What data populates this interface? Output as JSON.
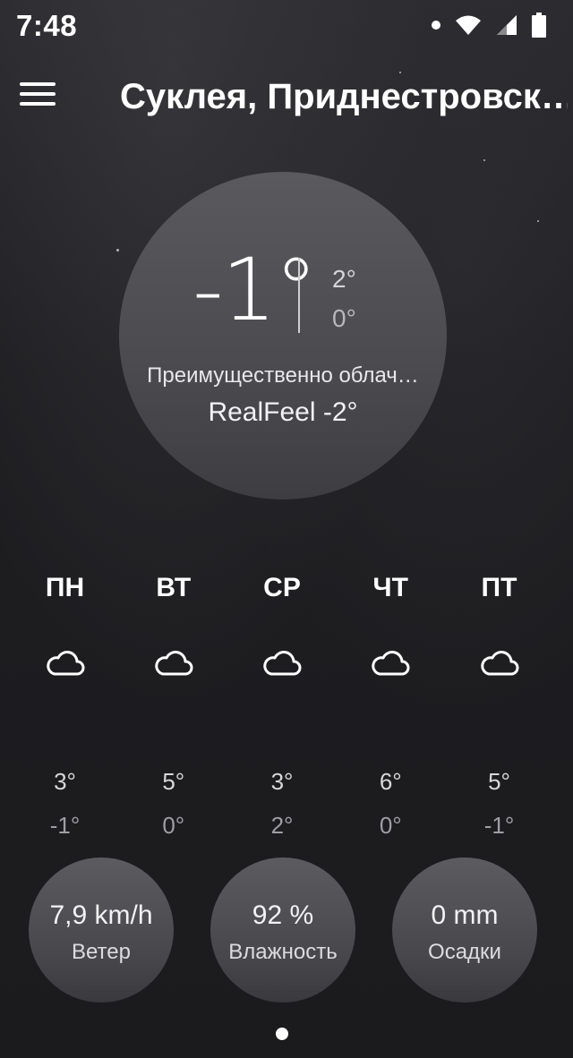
{
  "status_bar": {
    "time": "7:48",
    "icons": [
      "notification-dot",
      "wifi-icon",
      "signal-icon",
      "battery-icon"
    ]
  },
  "app_bar": {
    "location": "Суклея, Приднестровск…"
  },
  "current": {
    "temperature": "-1°",
    "high": "2°",
    "low": "0°",
    "condition": "Преимущественно облач…",
    "realfeel": "RealFeel -2°"
  },
  "forecast": [
    {
      "day": "ПН",
      "icon": "cloud-icon",
      "high": "3°",
      "low": "-1°"
    },
    {
      "day": "ВТ",
      "icon": "cloud-icon",
      "high": "5°",
      "low": "0°"
    },
    {
      "day": "СР",
      "icon": "cloud-icon",
      "high": "3°",
      "low": "2°"
    },
    {
      "day": "ЧТ",
      "icon": "cloud-icon",
      "high": "6°",
      "low": "0°"
    },
    {
      "day": "ПТ",
      "icon": "cloud-icon",
      "high": "5°",
      "low": "-1°"
    }
  ],
  "stats": {
    "wind": {
      "value": "7,9 km/h",
      "label": "Ветер"
    },
    "humidity": {
      "value": "92 %",
      "label": "Влажность"
    },
    "precipitation": {
      "value": "0 mm",
      "label": "Осадки"
    }
  },
  "colors": {
    "background": "#1c1c1f",
    "circle": "#4b4b4f",
    "text": "#ffffff"
  }
}
